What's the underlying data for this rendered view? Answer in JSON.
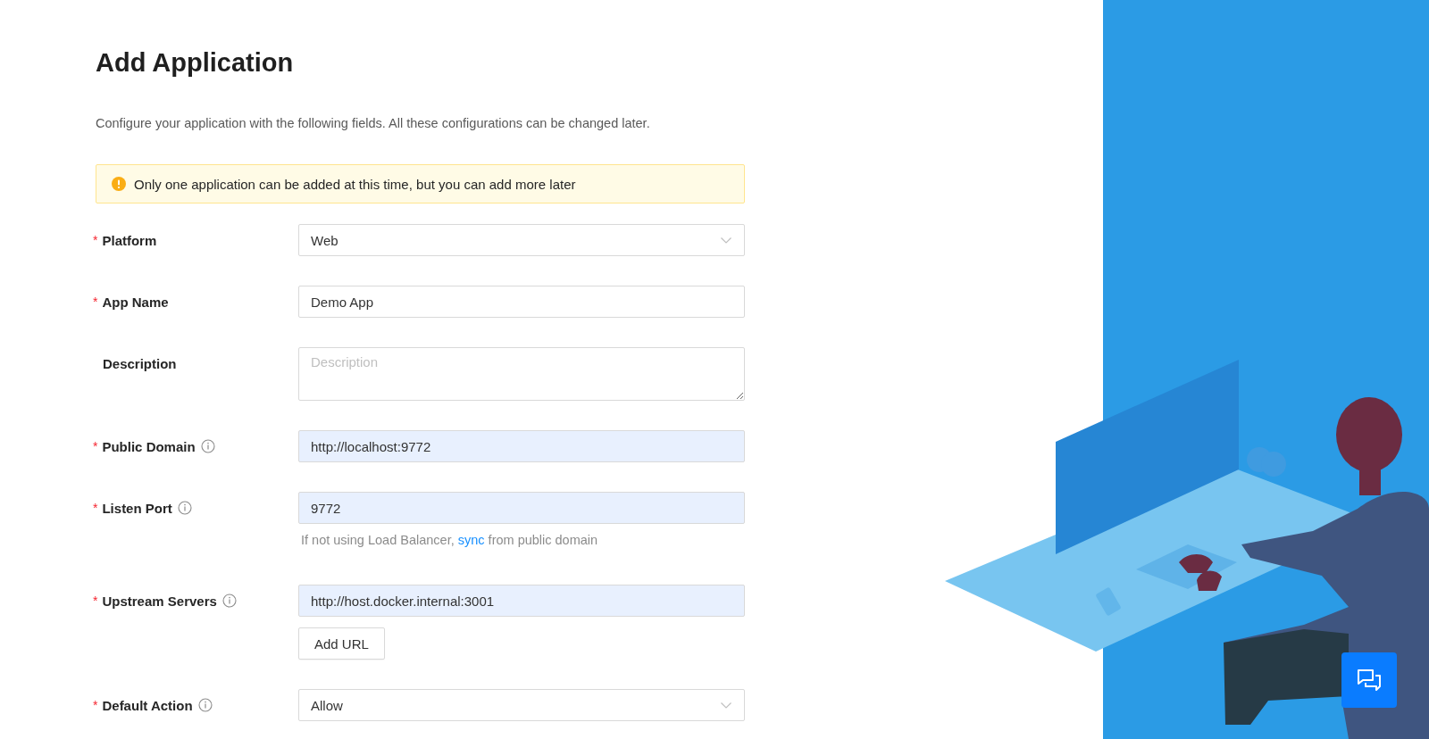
{
  "title": "Add Application",
  "intro": "Configure your application with the following fields. All these configurations can be changed later.",
  "alert": {
    "kind": "warning",
    "text": "Only one application can be added at this time, but you can add more later"
  },
  "fields": [
    {
      "required_mark": "*",
      "label": "Platform",
      "info": false,
      "kind": "select",
      "value": "Web",
      "autofilled": false
    },
    {
      "required_mark": "*",
      "label": "App Name",
      "info": false,
      "kind": "input",
      "value": "Demo App",
      "autofilled": false
    },
    {
      "label": "Description",
      "info": false,
      "kind": "textarea",
      "placeholder": "Description",
      "autofilled": false
    },
    {
      "required_mark": "*",
      "label": "Public Domain",
      "info": true,
      "kind": "input",
      "value": "http://localhost:9772",
      "autofilled": true
    },
    {
      "required_mark": "*",
      "label": "Listen Port",
      "info": true,
      "kind": "input",
      "value": "9772",
      "autofilled": true,
      "hint": {
        "before": "If not using Load Balancer, ",
        "link": "sync",
        "after": " from public domain"
      }
    },
    {
      "required_mark": "*",
      "label": "Upstream Servers",
      "info": true,
      "kind": "input",
      "value": "http://host.docker.internal:3001",
      "autofilled": true,
      "button": "Add URL"
    },
    {
      "required_mark": "*",
      "label": "Default Action",
      "info": true,
      "kind": "select",
      "value": "Allow",
      "autofilled": false
    }
  ]
}
